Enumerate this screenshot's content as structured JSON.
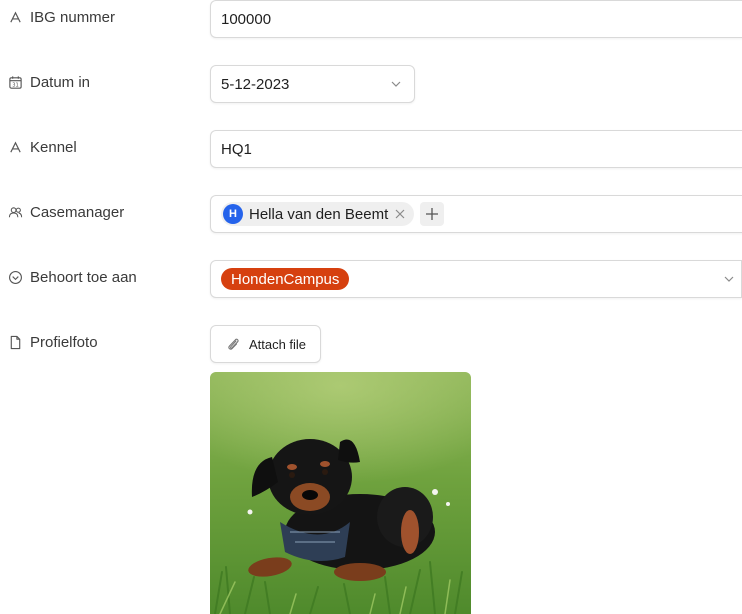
{
  "fields": {
    "ibg": {
      "label": "IBG nummer",
      "value": "100000",
      "icon": "text-type-icon"
    },
    "datum": {
      "label": "Datum in",
      "value": "5-12-2023",
      "icon": "calendar-icon"
    },
    "kennel": {
      "label": "Kennel",
      "value": "HQ1",
      "icon": "text-type-icon"
    },
    "casemanager": {
      "label": "Casemanager",
      "icon": "users-icon",
      "user": {
        "initial": "H",
        "name": "Hella van den Beemt"
      }
    },
    "behoort": {
      "label": "Behoort toe aan",
      "value": "HondenCampus",
      "icon": "dropdown-circle-icon"
    },
    "profielfoto": {
      "label": "Profielfoto",
      "icon": "file-icon",
      "attach_label": "Attach file",
      "image": "puppy-photo"
    }
  },
  "colors": {
    "avatar": "#2563eb",
    "tag": "#d6400f",
    "border": "#d9d9d9"
  }
}
